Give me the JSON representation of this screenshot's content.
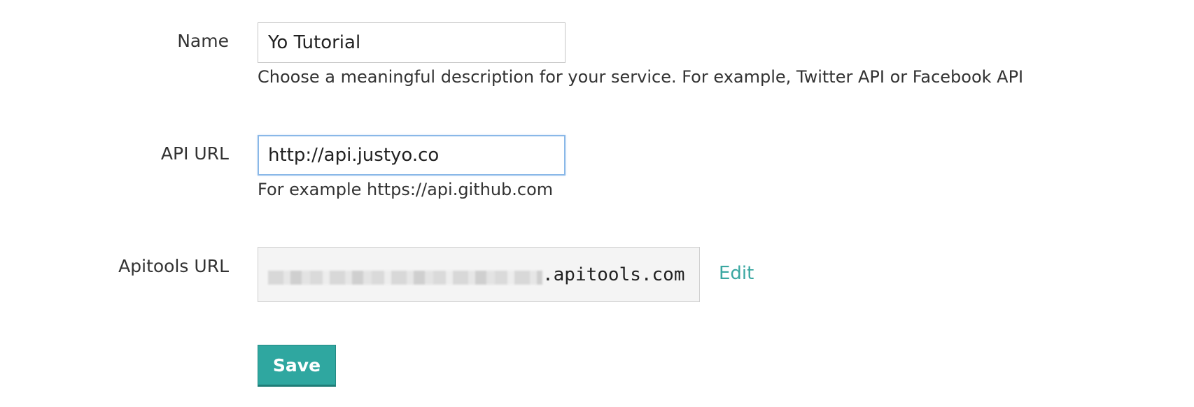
{
  "form": {
    "name": {
      "label": "Name",
      "value": "Yo Tutorial",
      "help": "Choose a meaningful description for your service. For example, Twitter API or Facebook API"
    },
    "api_url": {
      "label": "API URL",
      "value": "http://api.justyo.co",
      "help": "For example https://api.github.com"
    },
    "apitools_url": {
      "label": "Apitools URL",
      "domain_suffix": ".apitools.com",
      "edit_label": "Edit"
    },
    "save_label": "Save"
  },
  "colors": {
    "accent": "#2fa7a0",
    "link": "#3aa7a1",
    "focus_border": "#8ab8e8",
    "readonly_bg": "#f4f4f4"
  }
}
